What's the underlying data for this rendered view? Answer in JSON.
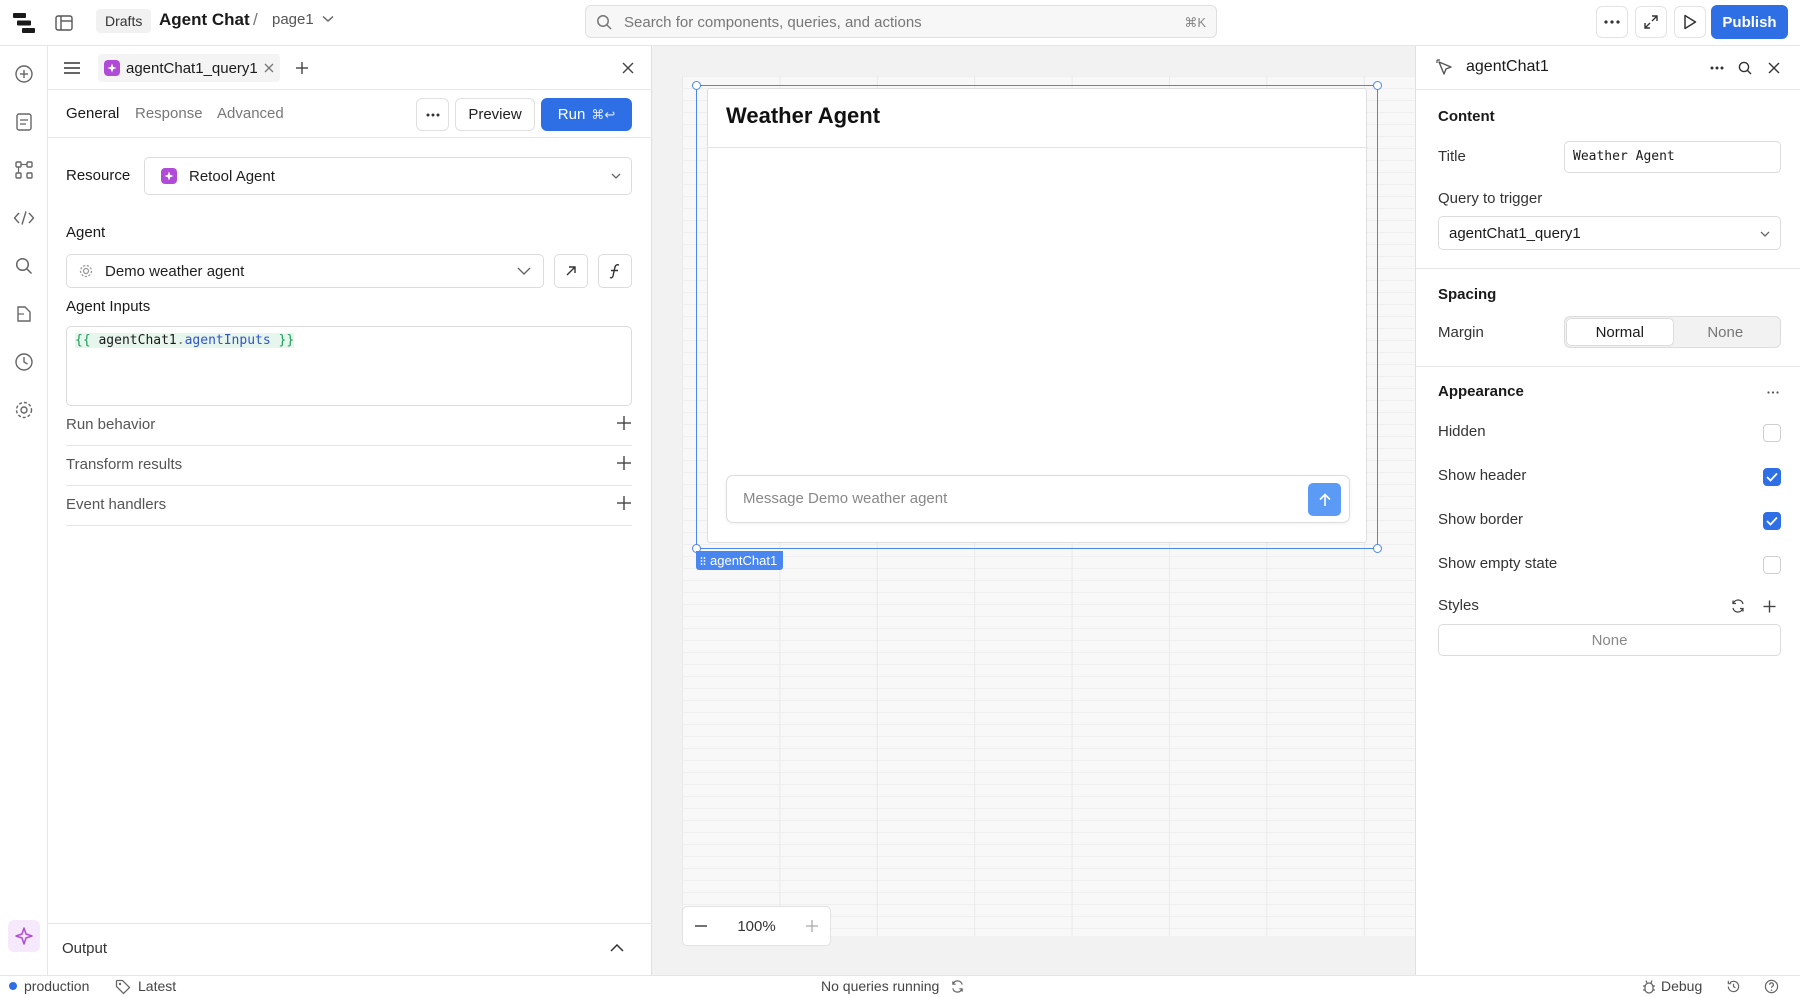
{
  "topbar": {
    "drafts_label": "Drafts",
    "app_title": "Agent Chat",
    "breadcrumb_sep": "/",
    "page_name": "page1",
    "search_placeholder": "Search for components, queries, and actions",
    "search_shortcut": "⌘K",
    "publish_label": "Publish"
  },
  "query_panel": {
    "tab_name": "agentChat1_query1",
    "subtabs": [
      "General",
      "Response",
      "Advanced"
    ],
    "preview_label": "Preview",
    "run_label": "Run",
    "run_shortcut": "⌘↩",
    "resource_label": "Resource",
    "resource_value": "Retool Agent",
    "agent_label": "Agent",
    "agent_value": "Demo weather agent",
    "agent_inputs_label": "Agent Inputs",
    "agent_inputs_code": {
      "open": "{{",
      "object": "agentChat1",
      "dot": ".",
      "property": "agentInputs",
      "close": "}}"
    },
    "sections": [
      "Run behavior",
      "Transform results",
      "Event handlers"
    ],
    "output_label": "Output"
  },
  "canvas": {
    "chat_title": "Weather Agent",
    "chat_placeholder": "Message Demo weather agent",
    "component_tag": "agentChat1",
    "zoom_level": "100%"
  },
  "inspector": {
    "component_name": "agentChat1",
    "content_section": "Content",
    "title_label": "Title",
    "title_value": "Weather Agent",
    "query_trigger_label": "Query to trigger",
    "query_trigger_value": "agentChat1_query1",
    "spacing_section": "Spacing",
    "margin_label": "Margin",
    "margin_options": [
      "Normal",
      "None"
    ],
    "margin_selected": "Normal",
    "appearance_section": "Appearance",
    "checkboxes": [
      {
        "label": "Hidden",
        "checked": false
      },
      {
        "label": "Show header",
        "checked": true
      },
      {
        "label": "Show border",
        "checked": true
      },
      {
        "label": "Show empty state",
        "checked": false
      }
    ],
    "styles_label": "Styles",
    "styles_value": "None"
  },
  "statusbar": {
    "environment": "production",
    "version": "Latest",
    "queries_status": "No queries running",
    "debug_label": "Debug"
  },
  "colors": {
    "accent": "#2f6fe6",
    "selection": "#4a86f0",
    "agent_purple": "#b04bd8",
    "env_dot": "#2f6fe6"
  },
  "icons": {
    "logo": "retool-logo-icon",
    "search": "search-icon",
    "send": "arrow-up-icon",
    "add": "plus-icon"
  }
}
